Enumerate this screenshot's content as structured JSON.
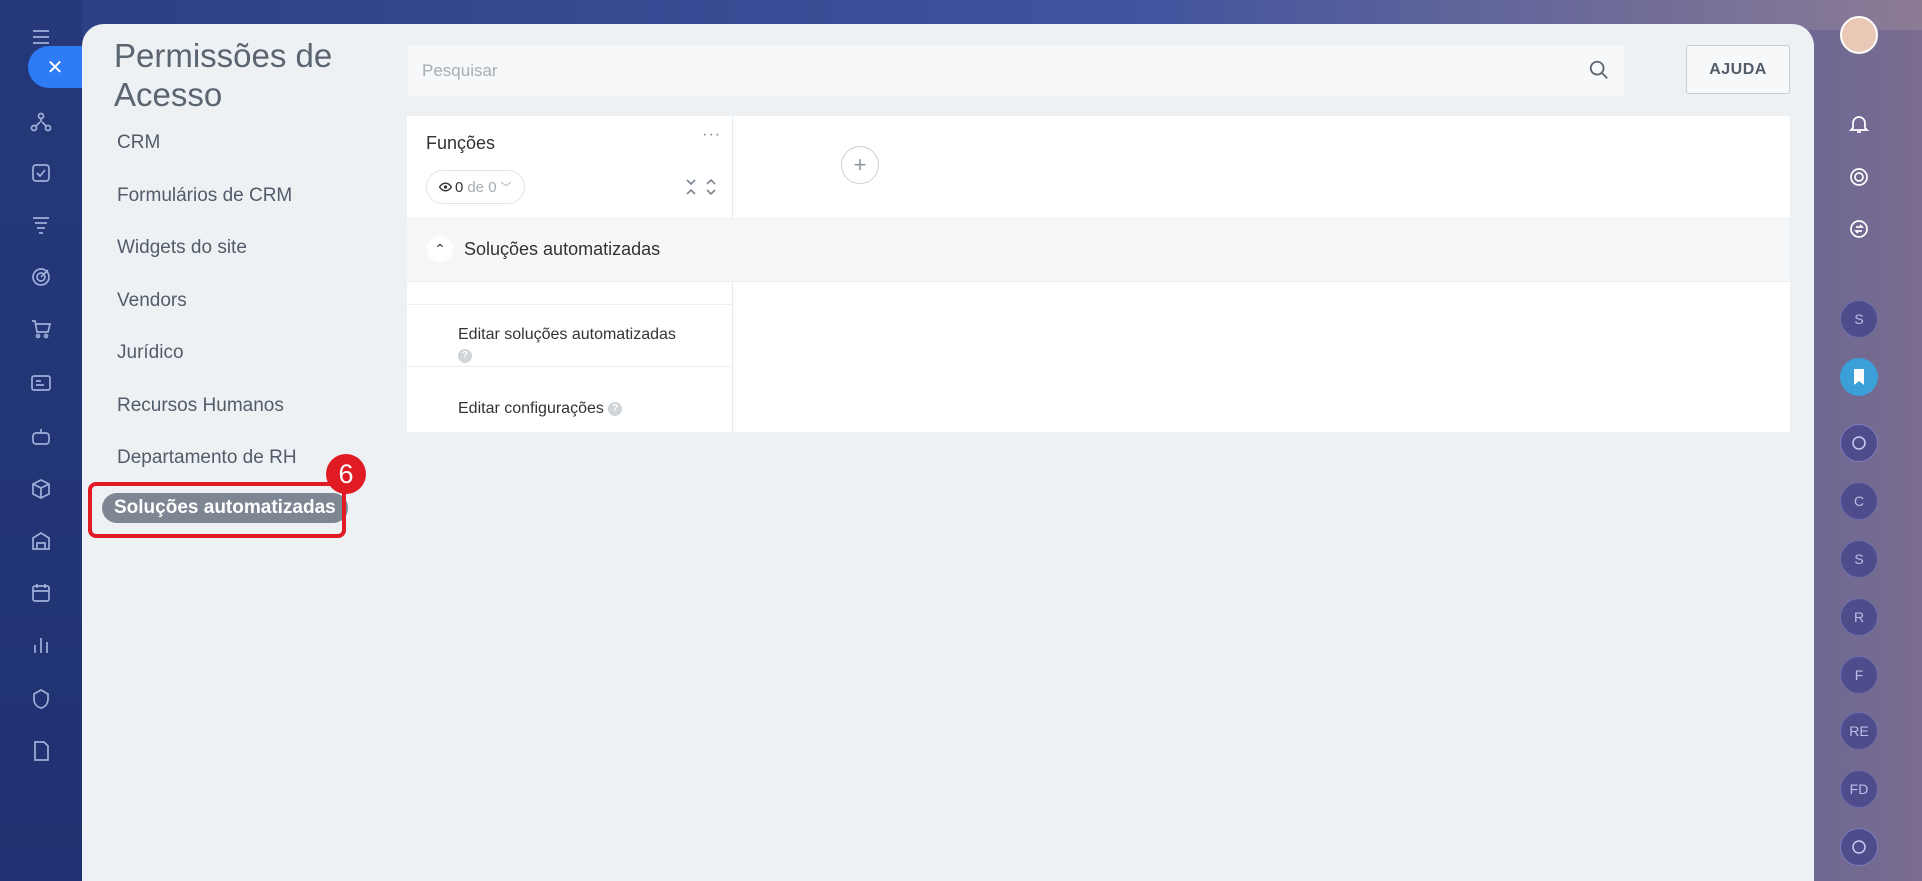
{
  "header": {
    "title": "Permissões de Acesso",
    "search_placeholder": "Pesquisar",
    "help_label": "AJUDA"
  },
  "sidebar": {
    "items": [
      {
        "label": "CRM"
      },
      {
        "label": "Formulários de CRM"
      },
      {
        "label": "Widgets do site"
      },
      {
        "label": "Vendors"
      },
      {
        "label": "Jurídico"
      },
      {
        "label": "Recursos Humanos"
      },
      {
        "label": "Departamento de RH"
      }
    ],
    "active_label": "Soluções automatizadas"
  },
  "annotation": {
    "step_number": "6",
    "color": "#e01b23"
  },
  "grid": {
    "roles_label": "Funções",
    "more_label": "···",
    "counter_value": "0",
    "counter_of": "de 0",
    "section_label": "Soluções automatizadas",
    "permissions": [
      {
        "label": "Editar soluções automatizadas"
      },
      {
        "label": "Editar configurações"
      }
    ]
  },
  "right_rail": {
    "avatars": [
      "S",
      "C",
      "S",
      "R",
      "F",
      "RE",
      "FD"
    ]
  },
  "colors": {
    "accent": "#2d7cf6",
    "active_nav": "#7d8692"
  }
}
